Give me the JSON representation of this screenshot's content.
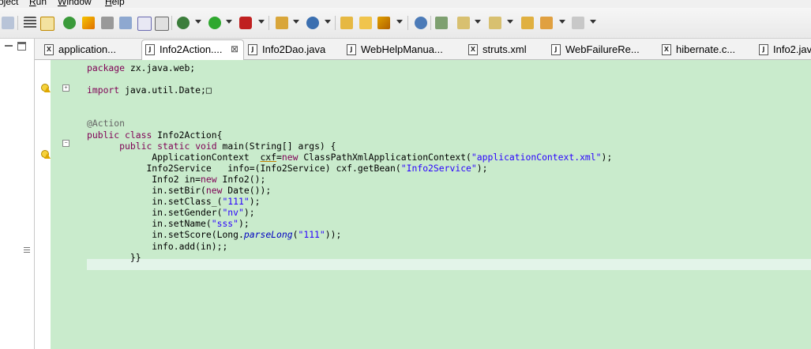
{
  "menu": {
    "items": [
      {
        "pre": "",
        "u": "",
        "post": "oject"
      },
      {
        "pre": "",
        "u": "R",
        "post": "un"
      },
      {
        "pre": "",
        "u": "W",
        "post": "indow"
      },
      {
        "pre": "",
        "u": "H",
        "post": "elp"
      }
    ]
  },
  "tabs": [
    {
      "icon": "X",
      "label": "application..."
    },
    {
      "icon": "J",
      "label": "Info2Action...."
    },
    {
      "icon": "J",
      "label": "Info2Dao.java"
    },
    {
      "icon": "J",
      "label": "WebHelpManua..."
    },
    {
      "icon": "X",
      "label": "struts.xml"
    },
    {
      "icon": "J",
      "label": "WebFailureRe..."
    },
    {
      "icon": "X",
      "label": "hibernate.c..."
    },
    {
      "icon": "J",
      "label": "Info2.java"
    }
  ],
  "active_tab_close": "⊠",
  "code": {
    "l1": {
      "kw": "package",
      "rest": " zx.java.web;"
    },
    "l3": {
      "kw": "import",
      "rest": " java.util.Date;",
      "box": "□"
    },
    "l6": {
      "ann": "@Action"
    },
    "l7": {
      "kw1": "public",
      "kw2": "class",
      "rest": " Info2Action{"
    },
    "l8": {
      "kw1": "public",
      "kw2": "static",
      "kw3": "void",
      "rest": " main(String[] args) {"
    },
    "l9": {
      "a": "ApplicationContext  ",
      "u": "cxf",
      "b": "=",
      "kw": "new",
      "c": " ClassPathXmlApplicationContext(",
      "s": "\"applicationContext.xml\"",
      "d": ");"
    },
    "l10": {
      "a": "Info2Service   info=(Info2Service) cxf.getBean(",
      "s": "\"Info2Service\"",
      "d": ");"
    },
    "l11": {
      "a": "Info2 in=",
      "kw": "new",
      "b": " Info2();"
    },
    "l12": {
      "a": "in.setBir(",
      "kw": "new",
      "b": " Date());"
    },
    "l13": {
      "a": "in.setClass_(",
      "s": "\"111\"",
      "d": ");"
    },
    "l14": {
      "a": "in.setGender(",
      "s": "\"nv\"",
      "d": ");"
    },
    "l15": {
      "a": "in.setName(",
      "s": "\"sss\"",
      "d": ");"
    },
    "l16": {
      "a": "in.setScore(Long.",
      "it": "parseLong",
      "b": "(",
      "s": "\"111\"",
      "d": "));"
    },
    "l17": {
      "a": "info.add(in);;"
    },
    "l18": {
      "a": "}"
    },
    "l24": {
      "a": "}"
    }
  },
  "colors": {
    "editor_bg": "#c9ebcc",
    "current_line": "#e3f4e9",
    "keyword": "#7f0055",
    "string": "#2a00ff"
  }
}
